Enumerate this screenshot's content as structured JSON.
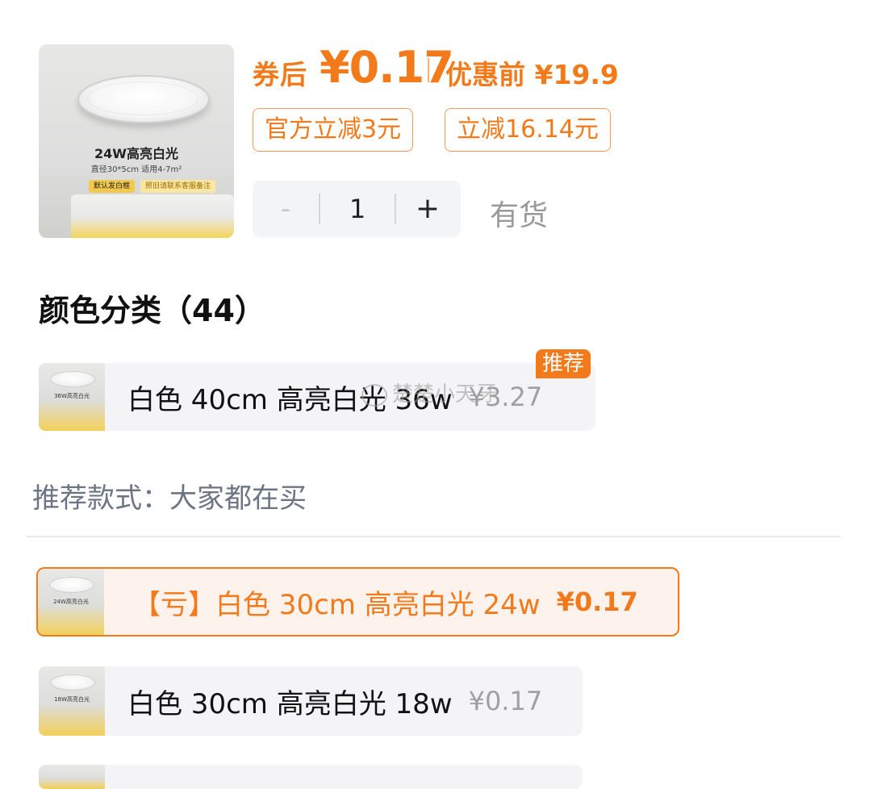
{
  "product": {
    "hero_title": "24W高亮白光",
    "hero_sub": "直径30*5cm 适用4-7m²",
    "hero_badge1": "默认发白框",
    "hero_badge2": "照旧请联系客服备注"
  },
  "price": {
    "after_label": "券后",
    "after_value": "¥0.17",
    "before_label": "优惠前",
    "before_value": "¥19.9"
  },
  "tags": [
    "官方立减3元",
    "立减16.14元"
  ],
  "stepper": {
    "minus": "-",
    "value": "1",
    "plus": "+"
  },
  "stock": "有货",
  "section_title": "颜色分类（44）",
  "recommended_badge": "推荐",
  "variants_top": [
    {
      "label": "白色 40cm 高亮白光 36w",
      "price": "¥3.27",
      "thumb_text": "36W高亮白光"
    }
  ],
  "watermark": "楚楚小天牙",
  "recommend_label": "推荐款式：大家都在买",
  "variants": [
    {
      "label": "【亏】白色 30cm 高亮白光 24w",
      "price": "¥0.17",
      "thumb_text": "24W高亮白光",
      "selected": true
    },
    {
      "label": "白色 30cm 高亮白光 18w",
      "price": "¥0.17",
      "thumb_text": "18W高亮白光",
      "selected": false
    }
  ],
  "colors": {
    "accent": "#f27a1a",
    "muted_text": "#999999",
    "secondary_text": "#6b7584",
    "chip_bg": "#f4f4f6"
  }
}
